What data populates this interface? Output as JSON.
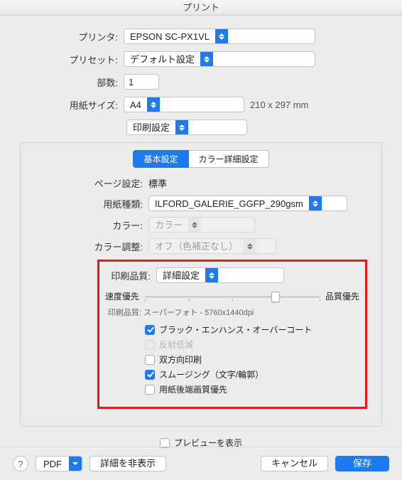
{
  "window_title": "プリント",
  "labels": {
    "printer": "プリンタ:",
    "preset": "プリセット:",
    "copies": "部数:",
    "paper_size": "用紙サイズ:",
    "section_dropdown": "印刷設定",
    "page_setup": "ページ設定:",
    "media_type": "用紙種類:",
    "color": "カラー:",
    "color_adjust": "カラー調整:",
    "print_quality": "印刷品質:",
    "speed_priority": "速度優先",
    "quality_priority": "品質優先",
    "quality_readout_label": "印刷品質:",
    "preview": "プレビューを表示",
    "pdf": "PDF",
    "details": "詳細を非表示",
    "cancel": "キャンセル",
    "save": "保存"
  },
  "values": {
    "printer": "EPSON SC-PX1VL",
    "preset": "デフォルト設定",
    "copies": "1",
    "paper_size": "A4",
    "paper_dim": "210 x 297 mm",
    "page_setup": "標準",
    "media_type": "ILFORD_GALERIE_GGFP_290gsm",
    "color": "カラー",
    "color_adjust": "オフ（色補正なし）",
    "print_quality": "詳細設定",
    "quality_readout": "スーパーフォト - 5760x1440dpi"
  },
  "tabs": {
    "basic": "基本設定",
    "advanced_color": "カラー詳細設定"
  },
  "checkboxes": {
    "black_enhance": "ブラック・エンハンス・オーバーコート",
    "reflection": "反射低減",
    "bidirectional": "双方向印刷",
    "smoothing": "スムージング（文字/輪郭）",
    "trailing_edge": "用紙後端画質優先"
  },
  "chk_state": {
    "black_enhance": true,
    "reflection": false,
    "bidirectional": false,
    "smoothing": true,
    "trailing_edge": false,
    "preview": false
  }
}
